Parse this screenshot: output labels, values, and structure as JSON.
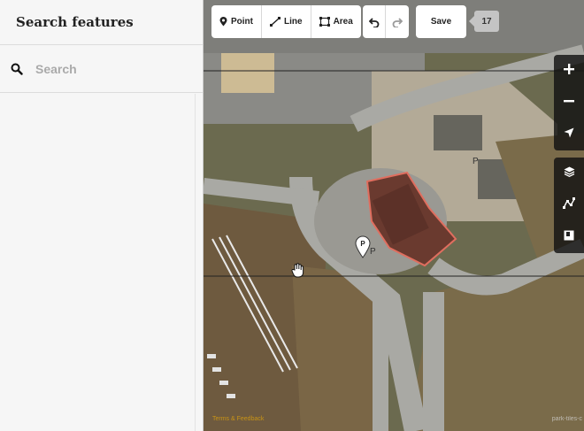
{
  "sidebar": {
    "title": "Search features",
    "search": {
      "placeholder": "Search",
      "value": ""
    }
  },
  "toolbar": {
    "point_label": "Point",
    "line_label": "Line",
    "area_label": "Area",
    "save_label": "Save",
    "save_count": "17"
  },
  "map": {
    "attribution": "Terms & Feedback",
    "imagery_credit": "park-tiles-c",
    "pin_label": "P",
    "parking_labels": [
      "P",
      "P"
    ]
  },
  "icons": {
    "search": "search-icon",
    "point": "point-pin-icon",
    "line": "line-icon",
    "area": "area-icon",
    "undo": "undo-icon",
    "redo": "redo-icon",
    "zoom_in": "plus-icon",
    "zoom_out": "minus-icon",
    "geolocate": "locate-arrow-icon",
    "background": "layers-icon",
    "map_data": "map-data-icon",
    "issues": "issues-icon"
  },
  "colors": {
    "accent_building": "#e06e5f",
    "attribution": "#c89316"
  }
}
